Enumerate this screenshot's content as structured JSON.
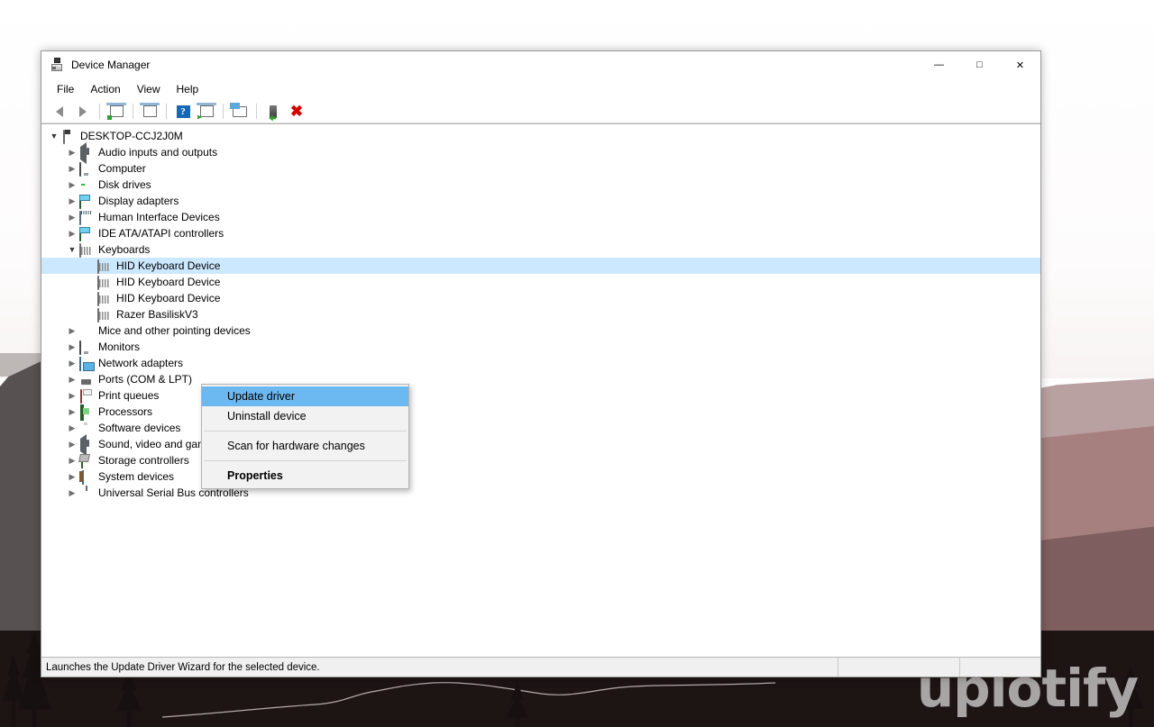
{
  "window": {
    "title": "Device Manager",
    "app_icon": "device-manager-icon",
    "caption": {
      "minimize": "—",
      "maximize": "□",
      "close": "✕"
    }
  },
  "menubar": {
    "items": [
      {
        "label": "File"
      },
      {
        "label": "Action"
      },
      {
        "label": "View"
      },
      {
        "label": "Help"
      }
    ]
  },
  "toolbar": {
    "buttons": [
      {
        "name": "back-button",
        "icon": "arrow-left-icon"
      },
      {
        "name": "forward-button",
        "icon": "arrow-right-icon"
      },
      {
        "name": "properties-button",
        "icon": "properties-window-icon"
      },
      {
        "name": "show-hidden-button",
        "icon": "document-window-icon"
      },
      {
        "name": "help-button",
        "icon": "question-mark-icon"
      },
      {
        "name": "scan-changes-button",
        "icon": "scan-window-icon"
      },
      {
        "name": "update-driver-button",
        "icon": "monitor-search-icon"
      },
      {
        "name": "enable-device-button",
        "icon": "device-enable-icon"
      },
      {
        "name": "uninstall-device-button",
        "icon": "red-x-icon"
      }
    ]
  },
  "tree": {
    "root": {
      "label": "DESKTOP-CCJ2J0M",
      "icon": "computer-icon",
      "expanded": true
    },
    "items": [
      {
        "label": "Audio inputs and outputs",
        "icon": "speaker-icon",
        "depth": 1,
        "state": "collapsed"
      },
      {
        "label": "Computer",
        "icon": "monitor-icon",
        "depth": 1,
        "state": "collapsed"
      },
      {
        "label": "Disk drives",
        "icon": "disk-icon",
        "depth": 1,
        "state": "collapsed"
      },
      {
        "label": "Display adapters",
        "icon": "display-adapter-icon",
        "depth": 1,
        "state": "collapsed"
      },
      {
        "label": "Human Interface Devices",
        "icon": "hid-icon",
        "depth": 1,
        "state": "collapsed"
      },
      {
        "label": "IDE ATA/ATAPI controllers",
        "icon": "ide-controller-icon",
        "depth": 1,
        "state": "collapsed"
      },
      {
        "label": "Keyboards",
        "icon": "keyboard-icon",
        "depth": 1,
        "state": "expanded"
      },
      {
        "label": "HID Keyboard Device",
        "icon": "keyboard-icon",
        "depth": 2,
        "state": "leaf",
        "selected": true
      },
      {
        "label": "HID Keyboard Device",
        "icon": "keyboard-icon",
        "depth": 2,
        "state": "leaf"
      },
      {
        "label": "HID Keyboard Device",
        "icon": "keyboard-icon",
        "depth": 2,
        "state": "leaf"
      },
      {
        "label": "Razer BasiliskV3",
        "icon": "keyboard-icon",
        "depth": 2,
        "state": "leaf"
      },
      {
        "label": "Mice and other pointing devices",
        "icon": "mouse-icon",
        "depth": 1,
        "state": "collapsed"
      },
      {
        "label": "Monitors",
        "icon": "monitor-icon",
        "depth": 1,
        "state": "collapsed"
      },
      {
        "label": "Network adapters",
        "icon": "network-icon",
        "depth": 1,
        "state": "collapsed"
      },
      {
        "label": "Ports (COM & LPT)",
        "icon": "port-icon",
        "depth": 1,
        "state": "collapsed"
      },
      {
        "label": "Print queues",
        "icon": "printer-icon",
        "depth": 1,
        "state": "collapsed"
      },
      {
        "label": "Processors",
        "icon": "cpu-icon",
        "depth": 1,
        "state": "collapsed"
      },
      {
        "label": "Software devices",
        "icon": "software-device-icon",
        "depth": 1,
        "state": "collapsed"
      },
      {
        "label": "Sound, video and game controllers",
        "icon": "speaker-icon",
        "depth": 1,
        "state": "collapsed"
      },
      {
        "label": "Storage controllers",
        "icon": "storage-controller-icon",
        "depth": 1,
        "state": "collapsed"
      },
      {
        "label": "System devices",
        "icon": "system-device-icon",
        "depth": 1,
        "state": "collapsed"
      },
      {
        "label": "Universal Serial Bus controllers",
        "icon": "usb-icon",
        "depth": 1,
        "state": "collapsed"
      }
    ]
  },
  "context_menu": {
    "visible": true,
    "highlight_color": "#6cb8f0",
    "entries": [
      {
        "label": "Update driver",
        "kind": "item",
        "highlighted": true
      },
      {
        "label": "Uninstall device",
        "kind": "item"
      },
      {
        "kind": "separator"
      },
      {
        "label": "Scan for hardware changes",
        "kind": "item"
      },
      {
        "kind": "separator"
      },
      {
        "label": "Properties",
        "kind": "item",
        "bold": true
      }
    ]
  },
  "statusbar": {
    "message": "Launches the Update Driver Wizard for the selected device.",
    "panel2": "",
    "panel3": ""
  },
  "desktop": {
    "watermark": "uplotify"
  }
}
